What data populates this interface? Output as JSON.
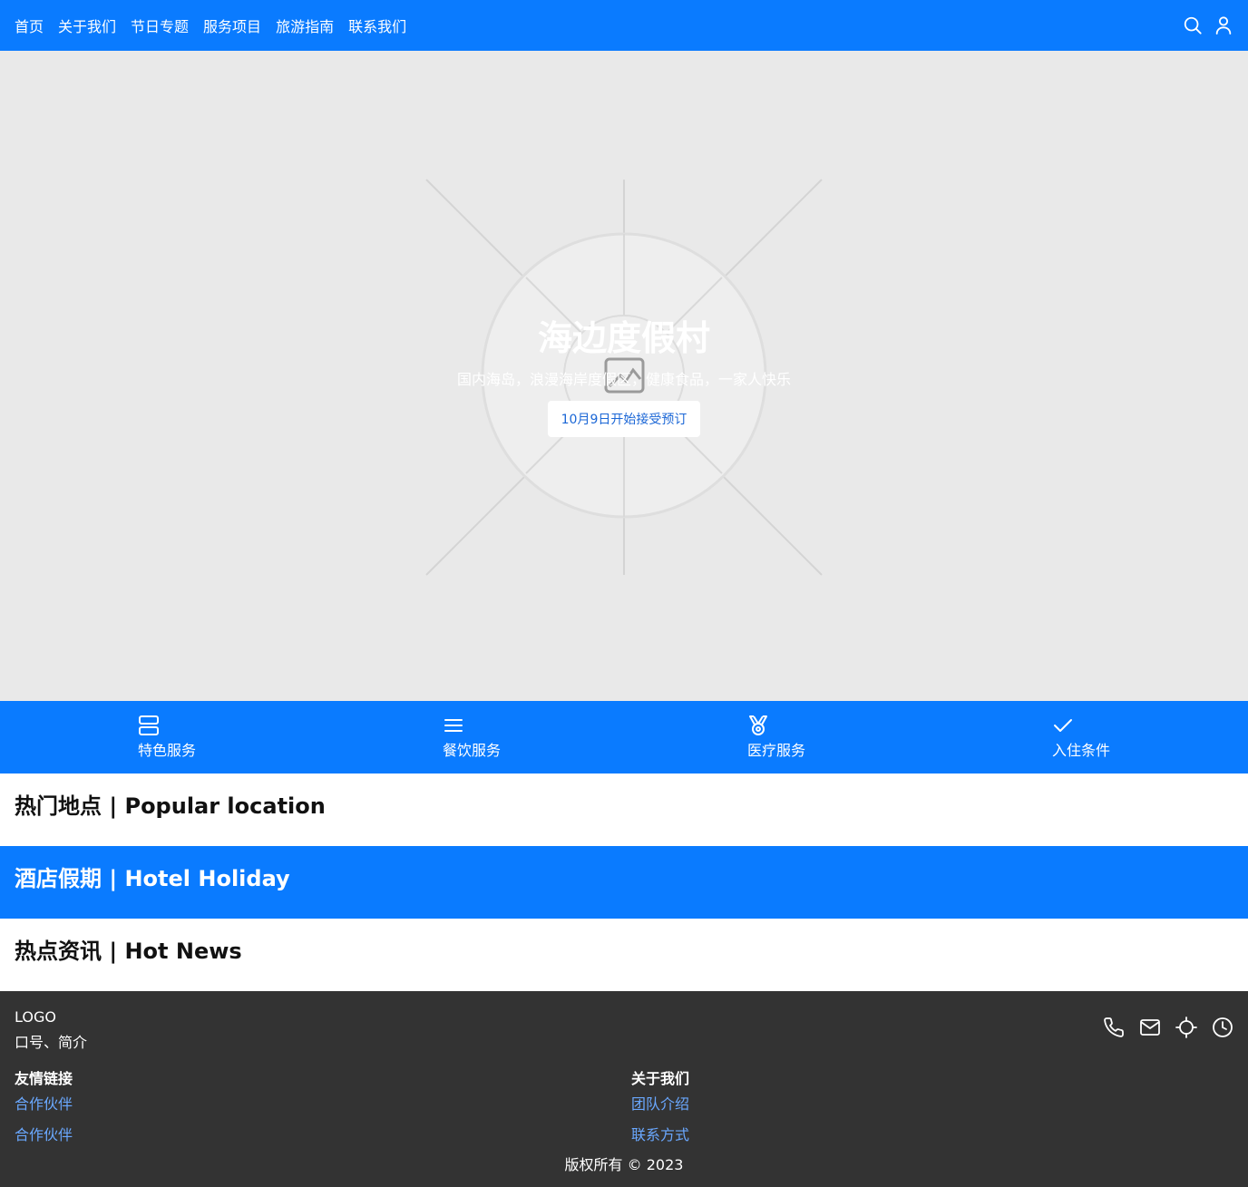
{
  "nav": {
    "links": [
      "首页",
      "关于我们",
      "节日专题",
      "服务项目",
      "旅游指南",
      "联系我们"
    ],
    "icons": [
      "search-icon",
      "user-icon"
    ]
  },
  "hero": {
    "title": "海边度假村",
    "subtitle": "国内海岛，浪漫海岸度假区，健康食品，一家人快乐",
    "button_label": "10月9日开始接受预订",
    "placeholder_icon": "image-placeholder-icon"
  },
  "services": [
    {
      "label": "特色服务",
      "icon": "server-icon"
    },
    {
      "label": "餐饮服务",
      "icon": "menu-icon"
    },
    {
      "label": "医疗服务",
      "icon": "medal-icon"
    },
    {
      "label": "入住条件",
      "icon": "check-icon"
    }
  ],
  "sections": {
    "popular": "热门地点 | Popular location",
    "hotel": "酒店假期 | Hotel Holiday",
    "news": "热点资讯 | Hot News"
  },
  "footer": {
    "logo": "LOGO",
    "slogan": "口号、简介",
    "icons": [
      "phone-icon",
      "mail-icon",
      "location-icon",
      "clock-icon"
    ],
    "col_left": {
      "title": "友情链接",
      "links": [
        "合作伙伴",
        "合作伙伴"
      ]
    },
    "col_right": {
      "title": "关于我们",
      "links": [
        "团队介绍",
        "联系方式"
      ]
    },
    "copyright": "版权所有 © 2023"
  },
  "colors": {
    "primary": "#0a7bff",
    "hero_bg": "#e9e9e9",
    "footer_bg": "#333333",
    "footer_link": "#6aa8ff",
    "button_text": "#1a66d6"
  }
}
